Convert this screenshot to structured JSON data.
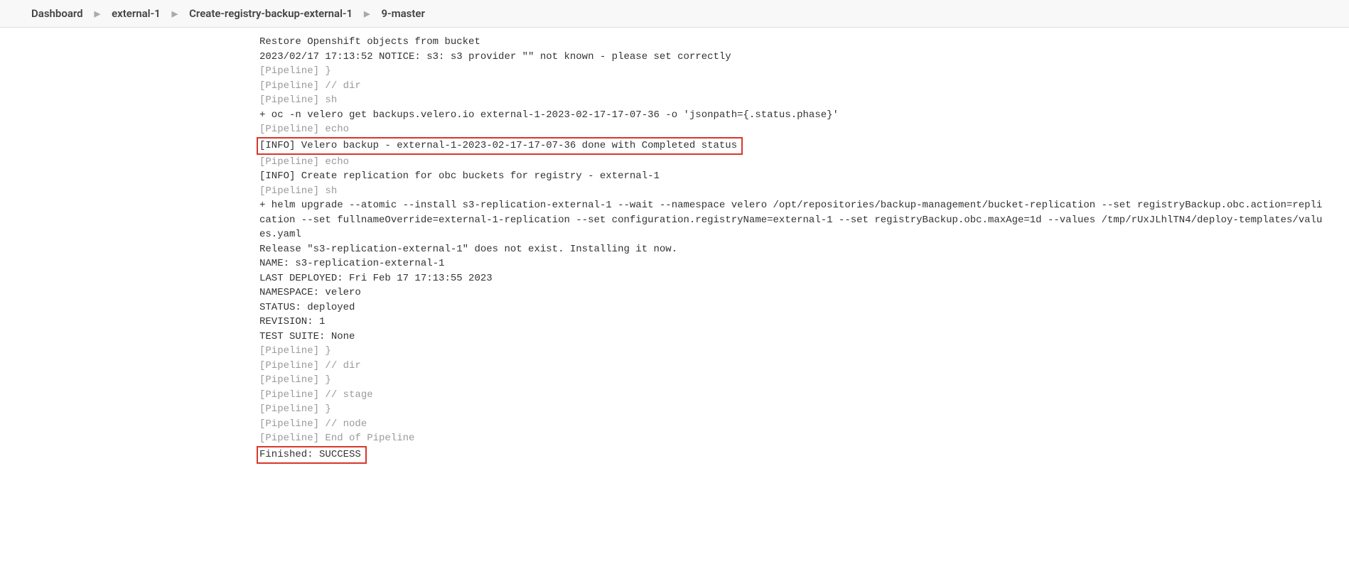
{
  "breadcrumb": {
    "items": [
      {
        "label": "Dashboard"
      },
      {
        "label": "external-1"
      },
      {
        "label": "Create-registry-backup-external-1"
      },
      {
        "label": "9-master"
      }
    ]
  },
  "console": {
    "lines": [
      {
        "text": "Restore Openshift objects from bucket",
        "dim": false,
        "highlight": false
      },
      {
        "text": "2023/02/17 17:13:52 NOTICE: s3: s3 provider \"\" not known - please set correctly",
        "dim": false,
        "highlight": false
      },
      {
        "text": "[Pipeline] }",
        "dim": true,
        "highlight": false
      },
      {
        "text": "[Pipeline] // dir",
        "dim": true,
        "highlight": false
      },
      {
        "text": "[Pipeline] sh",
        "dim": true,
        "highlight": false
      },
      {
        "text": "+ oc -n velero get backups.velero.io external-1-2023-02-17-17-07-36 -o 'jsonpath={.status.phase}'",
        "dim": false,
        "highlight": false
      },
      {
        "text": "[Pipeline] echo",
        "dim": true,
        "highlight": false
      },
      {
        "text": "[INFO] Velero backup - external-1-2023-02-17-17-07-36 done with Completed status",
        "dim": false,
        "highlight": true
      },
      {
        "text": "[Pipeline] echo",
        "dim": true,
        "highlight": false
      },
      {
        "text": "[INFO] Create replication for obc buckets for registry - external-1",
        "dim": false,
        "highlight": false
      },
      {
        "text": "[Pipeline] sh",
        "dim": true,
        "highlight": false
      },
      {
        "text": "+ helm upgrade --atomic --install s3-replication-external-1 --wait --namespace velero /opt/repositories/backup-management/bucket-replication --set registryBackup.obc.action=replication --set fullnameOverride=external-1-replication --set configuration.registryName=external-1 --set registryBackup.obc.maxAge=1d --values /tmp/rUxJLhlTN4/deploy-templates/values.yaml",
        "dim": false,
        "highlight": false,
        "wrap": true
      },
      {
        "text": "Release \"s3-replication-external-1\" does not exist. Installing it now.",
        "dim": false,
        "highlight": false
      },
      {
        "text": "NAME: s3-replication-external-1",
        "dim": false,
        "highlight": false
      },
      {
        "text": "LAST DEPLOYED: Fri Feb 17 17:13:55 2023",
        "dim": false,
        "highlight": false
      },
      {
        "text": "NAMESPACE: velero",
        "dim": false,
        "highlight": false
      },
      {
        "text": "STATUS: deployed",
        "dim": false,
        "highlight": false
      },
      {
        "text": "REVISION: 1",
        "dim": false,
        "highlight": false
      },
      {
        "text": "TEST SUITE: None",
        "dim": false,
        "highlight": false
      },
      {
        "text": "[Pipeline] }",
        "dim": true,
        "highlight": false
      },
      {
        "text": "[Pipeline] // dir",
        "dim": true,
        "highlight": false
      },
      {
        "text": "[Pipeline] }",
        "dim": true,
        "highlight": false
      },
      {
        "text": "[Pipeline] // stage",
        "dim": true,
        "highlight": false
      },
      {
        "text": "[Pipeline] }",
        "dim": true,
        "highlight": false
      },
      {
        "text": "[Pipeline] // node",
        "dim": true,
        "highlight": false
      },
      {
        "text": "[Pipeline] End of Pipeline",
        "dim": true,
        "highlight": false
      },
      {
        "text": "Finished: SUCCESS",
        "dim": false,
        "highlight": true
      }
    ]
  }
}
